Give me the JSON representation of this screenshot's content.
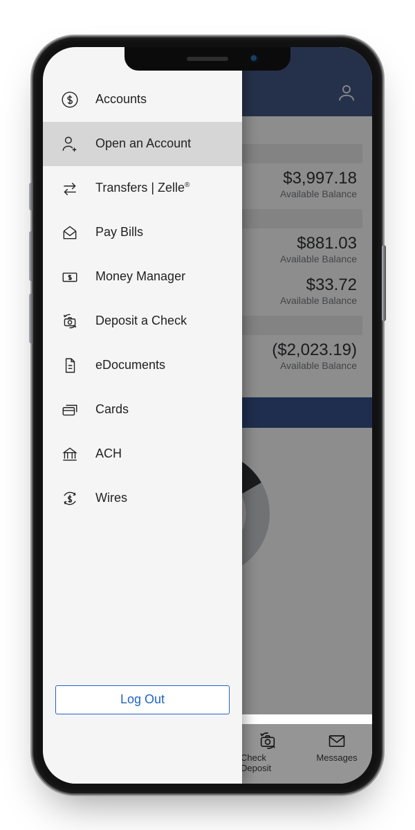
{
  "menu": {
    "items": [
      {
        "label": "Accounts"
      },
      {
        "label": "Open an Account"
      },
      {
        "label_html": "Transfers | Zelle<sup>®</sup>"
      },
      {
        "label": "Pay Bills"
      },
      {
        "label": "Money Manager"
      },
      {
        "label": "Deposit a Check"
      },
      {
        "label": "eDocuments"
      },
      {
        "label": "Cards"
      },
      {
        "label": "ACH"
      },
      {
        "label": "Wires"
      }
    ],
    "logout_label": "Log Out"
  },
  "background": {
    "accounts": [
      {
        "balance": "$3,997.18",
        "sub": "Available Balance"
      },
      {
        "balance": "$881.03",
        "sub": "Available Balance"
      },
      {
        "balance": "$33.72",
        "sub": "Available Balance"
      },
      {
        "balance": "($2,023.19)",
        "sub": "Available Balance"
      }
    ],
    "tabs": [
      {
        "label": "Check Deposit"
      },
      {
        "label": "Messages"
      }
    ]
  }
}
